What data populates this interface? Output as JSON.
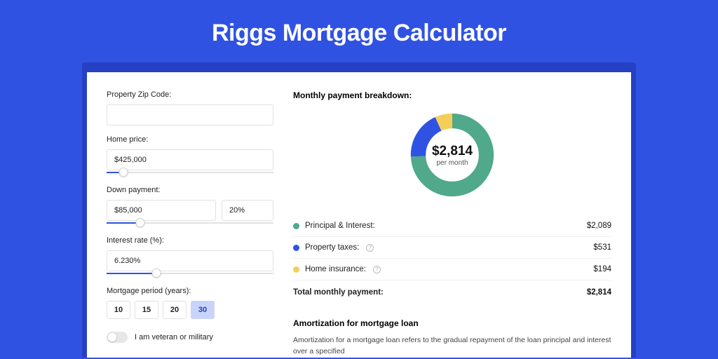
{
  "title": "Riggs Mortgage Calculator",
  "form": {
    "zip_label": "Property Zip Code:",
    "zip_value": "",
    "home_price_label": "Home price:",
    "home_price_value": "$425,000",
    "home_price_slider_pct": 10,
    "down_payment_label": "Down payment:",
    "down_payment_amount": "$85,000",
    "down_payment_pct": "20%",
    "down_payment_slider_pct": 20,
    "interest_label": "Interest rate (%):",
    "interest_value": "6.230%",
    "interest_slider_pct": 30,
    "period_label": "Mortgage period (years):",
    "periods": [
      "10",
      "15",
      "20",
      "30"
    ],
    "period_active": "30",
    "veteran_label": "I am veteran or military"
  },
  "breakdown": {
    "title": "Monthly payment breakdown:",
    "center_amount": "$2,814",
    "center_sub": "per month",
    "items": [
      {
        "label": "Principal & Interest:",
        "value": "$2,089",
        "color": "#4fa98a",
        "info": false
      },
      {
        "label": "Property taxes:",
        "value": "$531",
        "color": "#3052e3",
        "info": true
      },
      {
        "label": "Home insurance:",
        "value": "$194",
        "color": "#f3cf5a",
        "info": true
      }
    ],
    "total_label": "Total monthly payment:",
    "total_value": "$2,814"
  },
  "amortization": {
    "title": "Amortization for mortgage loan",
    "text": "Amortization for a mortgage loan refers to the gradual repayment of the loan principal and interest over a specified"
  },
  "chart_data": {
    "type": "pie",
    "title": "Monthly payment breakdown",
    "unit": "$",
    "total": 2814,
    "series": [
      {
        "name": "Principal & Interest",
        "value": 2089,
        "color": "#4fa98a"
      },
      {
        "name": "Property taxes",
        "value": 531,
        "color": "#3052e3"
      },
      {
        "name": "Home insurance",
        "value": 194,
        "color": "#f3cf5a"
      }
    ]
  }
}
